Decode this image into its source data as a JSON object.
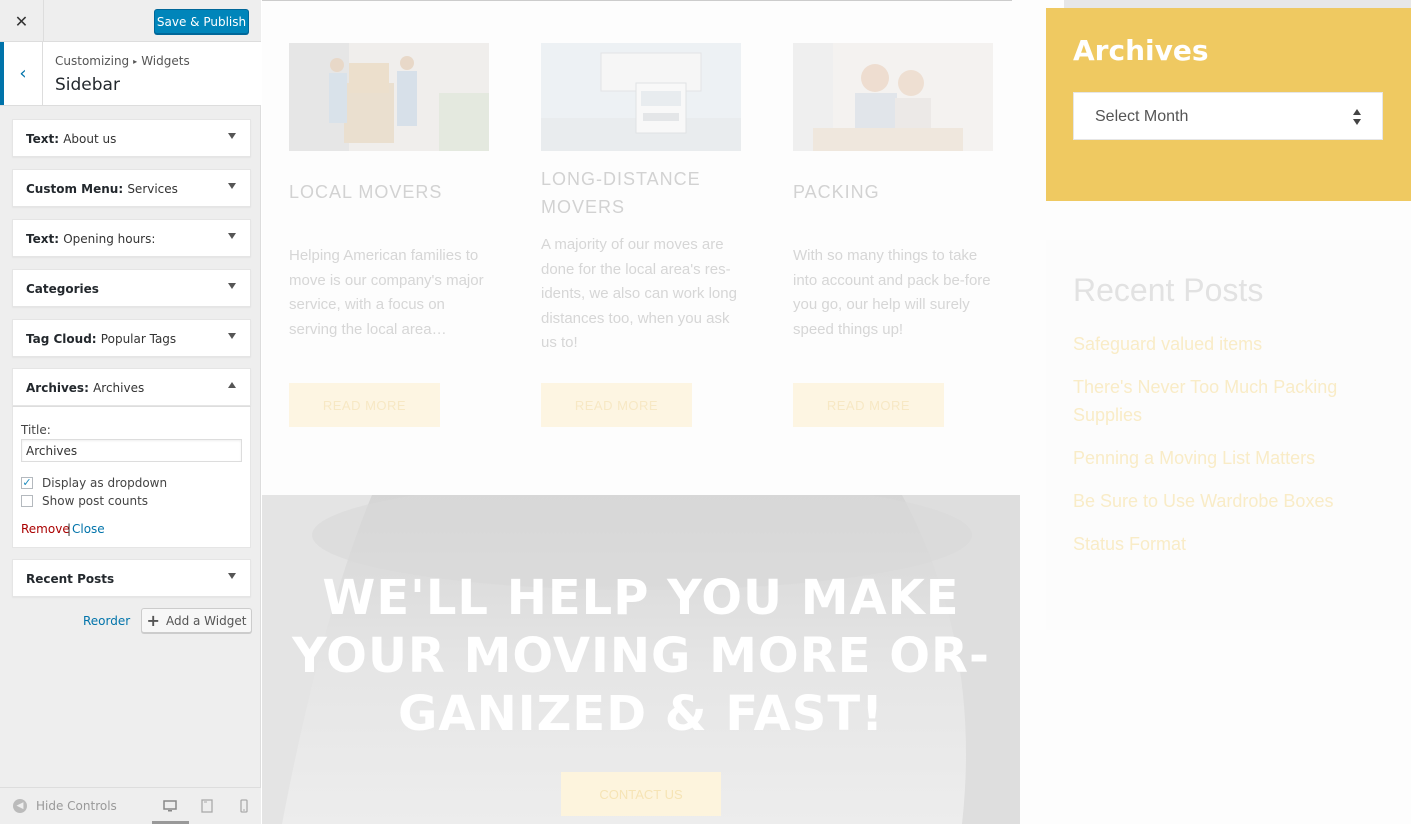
{
  "panel": {
    "close_glyph": "✕",
    "save_label": "Save & Publish",
    "breadcrumb": {
      "root": "Customizing",
      "separator": "▸",
      "current": "Widgets"
    },
    "section_title": "Sidebar",
    "back_glyph": "‹"
  },
  "widgets": [
    {
      "type": "Text:",
      "name": "About us",
      "expanded": false
    },
    {
      "type": "Custom Menu:",
      "name": "Services",
      "expanded": false
    },
    {
      "type": "Text:",
      "name": "Opening hours:",
      "expanded": false
    },
    {
      "type": "Categories",
      "name": "",
      "expanded": false
    },
    {
      "type": "Tag Cloud:",
      "name": "Popular Tags",
      "expanded": false
    },
    {
      "type": "Archives:",
      "name": "Archives",
      "expanded": true
    },
    {
      "type": "Recent Posts",
      "name": "",
      "expanded": false
    }
  ],
  "archives_form": {
    "title_label": "Title:",
    "title_value": "Archives",
    "display_dropdown_label": "Display as dropdown",
    "display_dropdown_checked": true,
    "show_counts_label": "Show post counts",
    "show_counts_checked": false,
    "remove_label": "Remove",
    "separator": "|",
    "close_label": "Close"
  },
  "actions": {
    "reorder_label": "Reorder",
    "add_widget_label": "Add a Widget"
  },
  "footer": {
    "hide_controls_label": "Hide Controls"
  },
  "preview": {
    "services": [
      {
        "title": "LOCAL MOVERS",
        "text": "Helping American families to move is our company's major service, with a focus on serving the local area…",
        "button": "READ MORE"
      },
      {
        "title": "LONG-DISTANCE MOVERS",
        "text": "A majority of our moves are done for the local area's res-idents, we also can work long distances too, when you ask us to!",
        "button": "READ MORE"
      },
      {
        "title": "PACKING",
        "text": "With so many things to take into account and pack be-fore you go, our help will surely speed things up!",
        "button": "READ MORE"
      }
    ],
    "hero": {
      "line1": "WE'LL HELP YOU MAKE",
      "line2": "YOUR MOVING MORE OR-",
      "line3": "GANIZED & FAST!",
      "button": "CONTACT US"
    },
    "sidebar": {
      "archives_title": "Archives",
      "archives_select": "Select Month",
      "recent_title": "Recent Posts",
      "recent_posts": [
        "Safeguard valued items",
        "There's Never Too Much Packing Supplies",
        "Penning a Moving List Matters",
        "Be Sure to Use Wardrobe Boxes",
        "Status Format"
      ]
    },
    "colors": {
      "accent": "#efc961",
      "wp_blue": "#0085ba"
    }
  }
}
